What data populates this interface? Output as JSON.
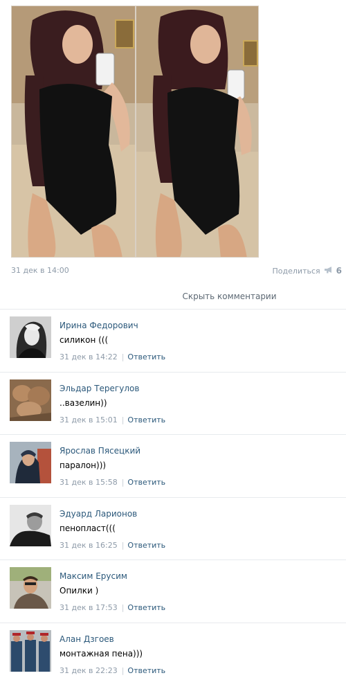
{
  "post": {
    "date": "31 дек в 14:00",
    "share_label": "Поделиться",
    "share_icon": "megaphone-icon",
    "share_count": "6"
  },
  "hide_comments_label": "Скрыть комментарии",
  "comments": [
    {
      "author": "Ирина Федорович",
      "text": "силикон (((",
      "time": "31 дек в 14:22",
      "reply": "Ответить"
    },
    {
      "author": "Эльдар Терегулов",
      "text": "..вазелин))",
      "time": "31 дек в 15:01",
      "reply": "Ответить"
    },
    {
      "author": "Ярослав Пясецкий",
      "text": "паралон)))",
      "time": "31 дек в 15:58",
      "reply": "Ответить"
    },
    {
      "author": "Эдуард Ларионов",
      "text": "пенопласт(((",
      "time": "31 дек в 16:25",
      "reply": "Ответить"
    },
    {
      "author": "Максим Ерусим",
      "text": "Опилки )",
      "time": "31 дек в 17:53",
      "reply": "Ответить"
    },
    {
      "author": "Алан Дзгоев",
      "text": "монтажная пена)))",
      "time": "31 дек в 22:23",
      "reply": "Ответить"
    }
  ],
  "colors": {
    "link": "#2b587a",
    "muted": "#8d9aa8",
    "divider": "#e7eaed"
  }
}
